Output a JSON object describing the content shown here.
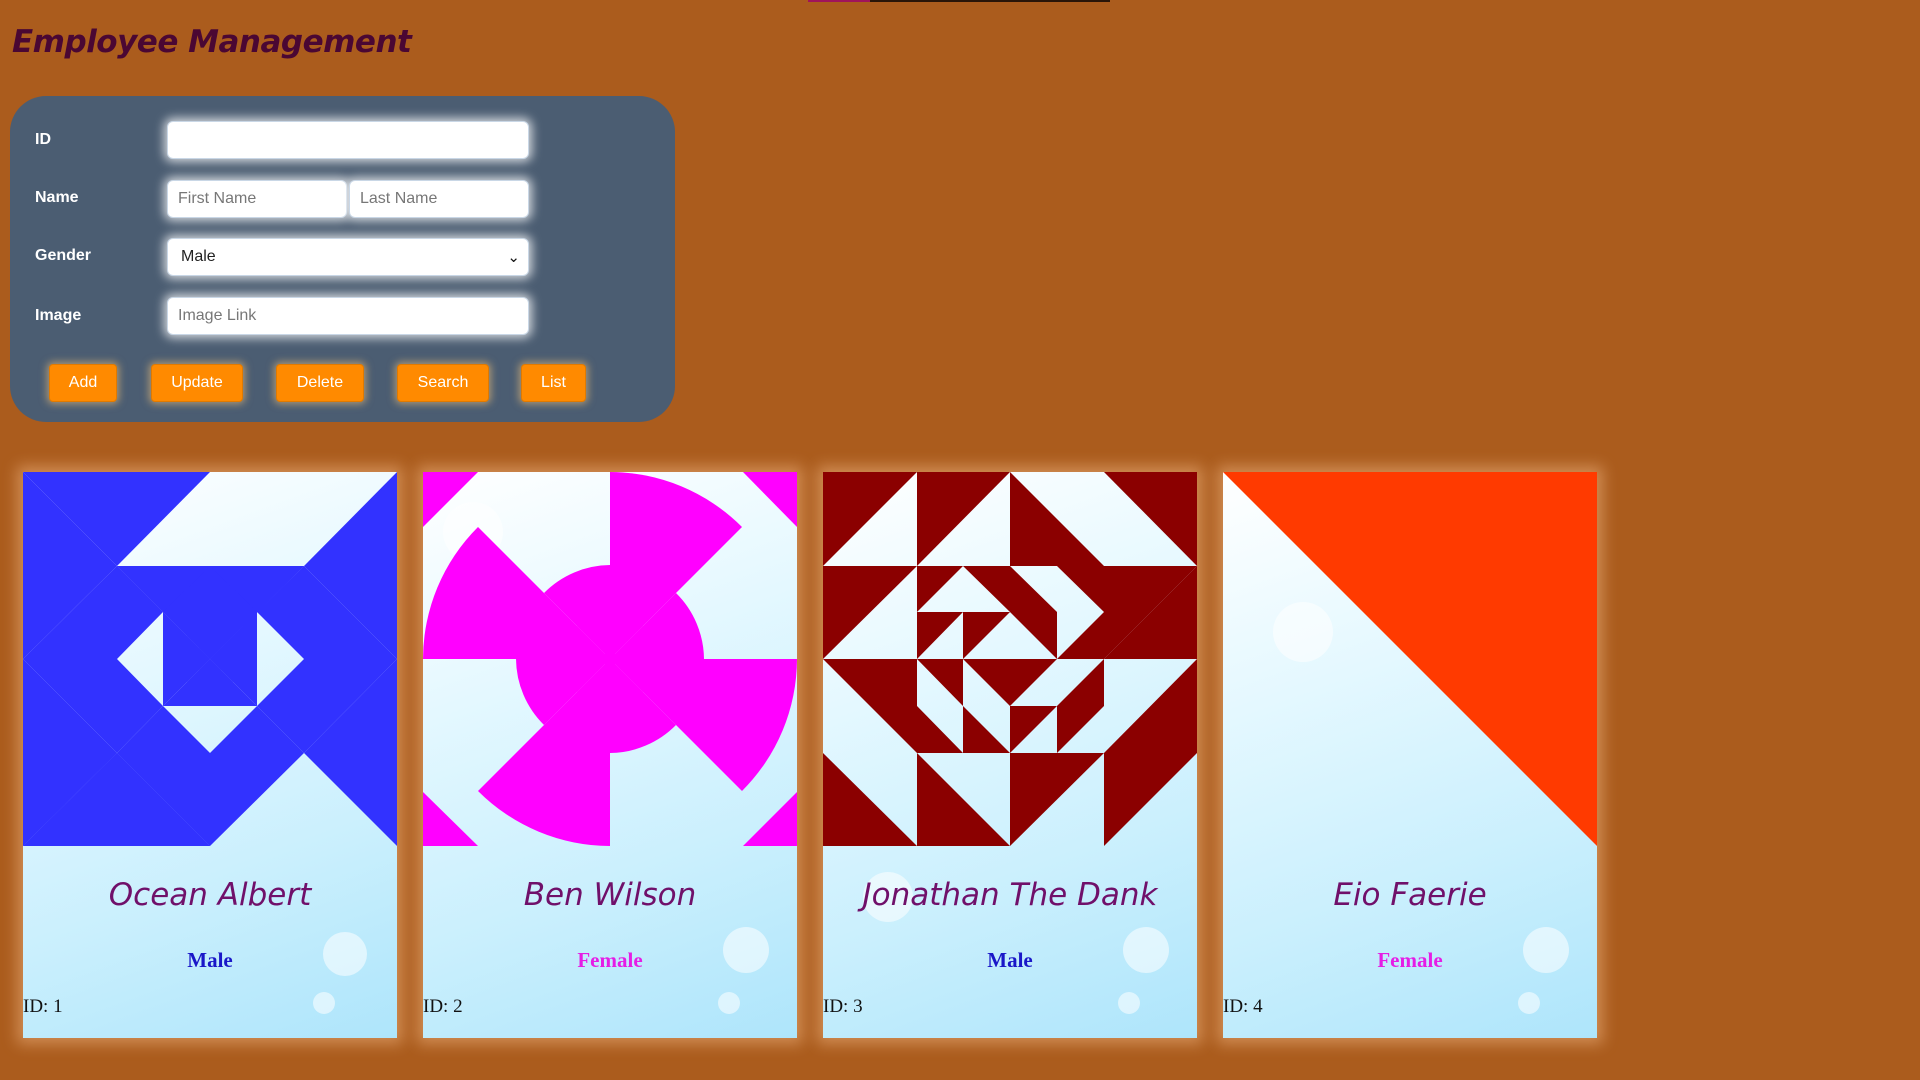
{
  "page": {
    "title": "Employee Management"
  },
  "form": {
    "id_label": "ID",
    "id_value": "",
    "name_label": "Name",
    "first_name_placeholder": "First Name",
    "last_name_placeholder": "Last Name",
    "gender_label": "Gender",
    "gender_selected": "Male",
    "image_label": "Image",
    "image_placeholder": "Image Link",
    "buttons": {
      "add": "Add",
      "update": "Update",
      "delete": "Delete",
      "search": "Search",
      "list": "List"
    }
  },
  "employees": [
    {
      "name": "Ocean Albert",
      "gender": "Male",
      "id_text": "ID: 1",
      "gender_color": "#1a17c8",
      "art_color": "#3232ff",
      "art_icon": "nested-diamond-pattern"
    },
    {
      "name": "Ben Wilson",
      "gender": "Female",
      "id_text": "ID: 2",
      "gender_color": "#e51ee5",
      "art_color": "#ff00ff",
      "art_icon": "concentric-circle-pattern"
    },
    {
      "name": "Jonathan The Dank",
      "gender": "Male",
      "id_text": "ID: 3",
      "gender_color": "#1a17c8",
      "art_color": "#8b0000",
      "art_icon": "triangle-pinwheel-pattern"
    },
    {
      "name": "Eio Faerie",
      "gender": "Female",
      "id_text": "ID: 4",
      "gender_color": "#e51ee5",
      "art_color": "#ff3a00",
      "art_icon": "diagonal-triangle-pattern"
    }
  ]
}
